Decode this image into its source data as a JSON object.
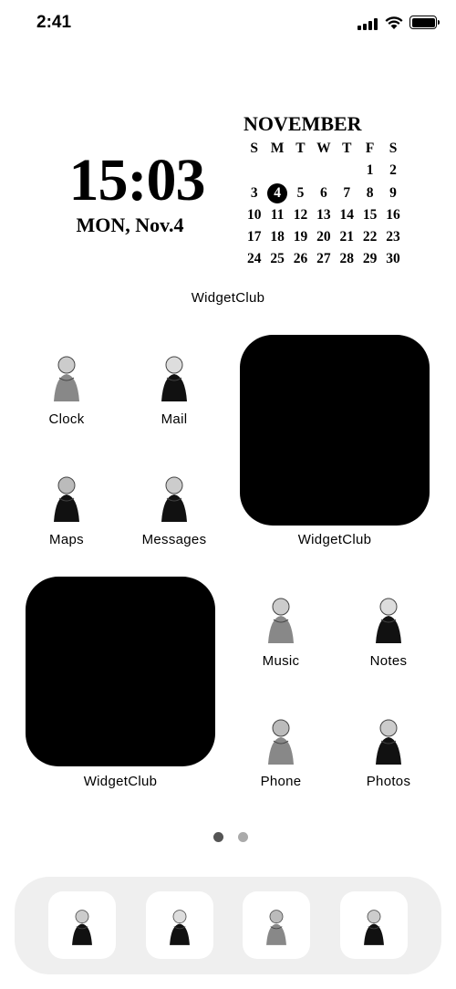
{
  "status_bar": {
    "time": "2:41"
  },
  "clock_widget": {
    "time": "15:03",
    "date": "MON, Nov.4"
  },
  "calendar_widget": {
    "month": "NOVEMBER",
    "weekdays": [
      "S",
      "M",
      "T",
      "W",
      "T",
      "F",
      "S"
    ],
    "days": [
      "",
      "",
      "",
      "",
      "",
      "1",
      "2",
      "3",
      "4",
      "5",
      "6",
      "7",
      "8",
      "9",
      "10",
      "11",
      "12",
      "13",
      "14",
      "15",
      "16",
      "17",
      "18",
      "19",
      "20",
      "21",
      "22",
      "23",
      "24",
      "25",
      "26",
      "27",
      "28",
      "29",
      "30"
    ],
    "today": "4"
  },
  "top_widget_label": "WidgetClub",
  "apps": [
    {
      "label": "Clock"
    },
    {
      "label": "Mail"
    },
    {
      "label": "Maps"
    },
    {
      "label": "Messages"
    },
    {
      "label": "Music"
    },
    {
      "label": "Notes"
    },
    {
      "label": "Phone"
    },
    {
      "label": "Photos"
    }
  ],
  "widgets": [
    {
      "label": "WidgetClub"
    },
    {
      "label": "WidgetClub"
    }
  ],
  "page_dots": {
    "count": 2,
    "active": 1
  },
  "dock": {
    "items": [
      "illustration-girl-1",
      "illustration-girl-2",
      "illustration-girl-3",
      "illustration-girl-4"
    ]
  },
  "colors": {
    "widget": "#000000",
    "dock": "#efefef",
    "dot_active": "#555555",
    "dot_inactive": "#aaaaaa"
  }
}
